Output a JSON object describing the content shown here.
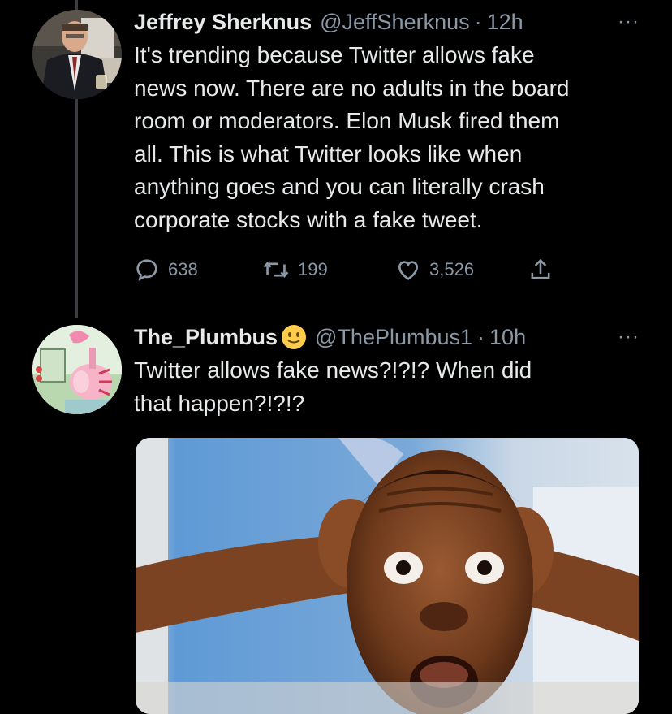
{
  "tweets": [
    {
      "name": "Jeffrey Sherknus",
      "handle": "@JeffSherknus",
      "separator": "·",
      "time": "12h",
      "more": "···",
      "lines": [
        "It's trending because Twitter allows fake",
        "news now. There are no adults in the board",
        "room or moderators. Elon Musk fired them",
        "all. This is what Twitter looks like when",
        "anything goes and you can literally crash",
        "corporate stocks with a fake tweet."
      ],
      "actions": {
        "replies": "638",
        "retweets": "199",
        "likes": "3,526"
      },
      "avatar_icon": "profile-photo"
    },
    {
      "name": "The_Plumbus",
      "name_emoji": "slightly-smiling-face-emoji",
      "handle": "@ThePlumbus1",
      "separator": "·",
      "time": "10h",
      "more": "···",
      "lines": [
        "Twitter allows fake news?!?!? When did",
        "that happen?!?!?"
      ],
      "avatar_icon": "plumbus-cartoon",
      "media": "shocked-face-photo"
    }
  ],
  "colors": {
    "background": "#000000",
    "text": "#e7e9ea",
    "muted": "#8b98a5",
    "thread_line": "#3a3d41"
  }
}
